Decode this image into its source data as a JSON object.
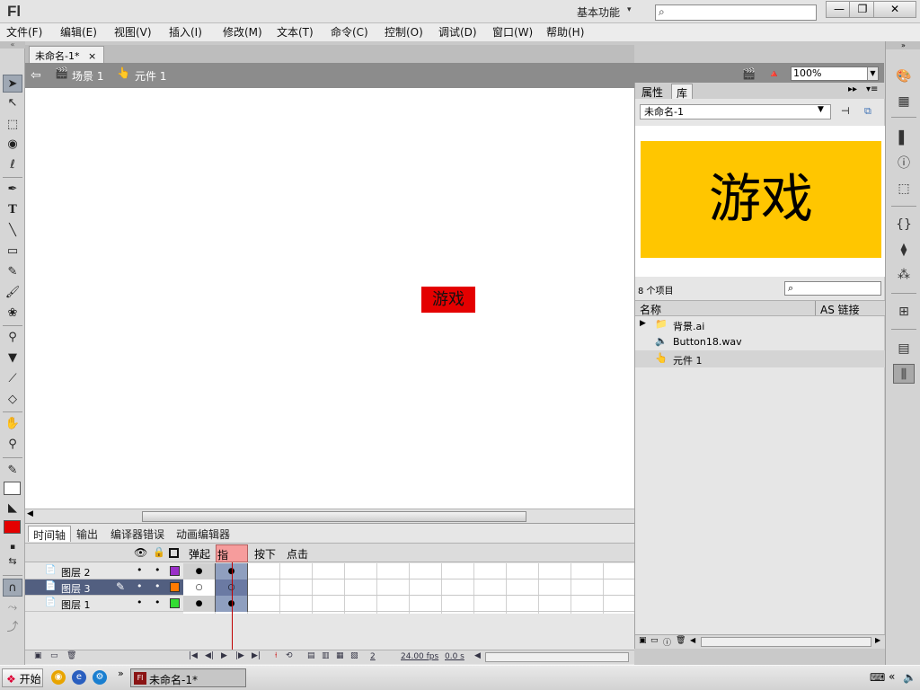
{
  "app": {
    "logo": "Fl",
    "workspace": "基本功能",
    "workspace_chevron": "▾"
  },
  "window_buttons": [
    "—",
    "❐",
    "✕"
  ],
  "menu": [
    "文件(F)",
    "编辑(E)",
    "视图(V)",
    "插入(I)",
    "修改(M)",
    "文本(T)",
    "命令(C)",
    "控制(O)",
    "调试(D)",
    "窗口(W)",
    "帮助(H)"
  ],
  "document": {
    "tab_label": "未命名-1*",
    "tab_close": "×"
  },
  "breadcrumb": {
    "scene": "场景 1",
    "symbol": "元件 1"
  },
  "zoom": "100%",
  "stage": {
    "symbol_text": "游戏",
    "symbol_color": "#e40000"
  },
  "timeline": {
    "tabs": [
      "时间轴",
      "输出",
      "编译器错误",
      "动画编辑器"
    ],
    "frame_labels": {
      "up": "弹起",
      "over": "指针...",
      "down": "按下",
      "hit": "点击"
    },
    "layers": [
      {
        "name": "图层 2",
        "color": "#9a2fc8",
        "selected": false
      },
      {
        "name": "图层 3",
        "color": "#ff7b00",
        "selected": true
      },
      {
        "name": "图层 1",
        "color": "#33dd33",
        "selected": false
      }
    ],
    "status": {
      "frame": "2",
      "fps": "24.00 fps",
      "time": "0.0 s"
    }
  },
  "library": {
    "tabs": [
      "属性",
      "库"
    ],
    "document": "未命名-1",
    "preview_text": "游戏",
    "preview_bg": "#ffc600",
    "count": "8 个项目",
    "columns": {
      "name": "名称",
      "linkage": "AS 链接"
    },
    "items": [
      {
        "icon": "folder-icon",
        "name": "背景.ai",
        "expand": "▶"
      },
      {
        "icon": "sound-icon",
        "name": "Button18.wav",
        "expand": ""
      },
      {
        "icon": "button-symbol-icon",
        "name": "元件 1",
        "expand": ""
      }
    ]
  },
  "taskbar": {
    "start": "开始",
    "task": "未命名-1*",
    "expand": "»"
  }
}
